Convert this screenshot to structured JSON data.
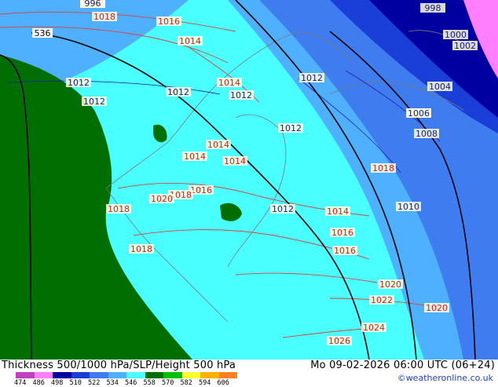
{
  "title": "Thickness 500/1000 hPa/SLP/Height 500 hPa",
  "datetime": "Mo 09-02-2026 06:00 UTC (06+24)",
  "credit": "©weatheronline.co.uk",
  "legend": {
    "ticks": [
      "474",
      "486",
      "498",
      "510",
      "522",
      "534",
      "546",
      "558",
      "570",
      "582",
      "594",
      "606"
    ],
    "colors": [
      "#c040c0",
      "#ff7fff",
      "#0000a0",
      "#1a3fd8",
      "#3f7cf0",
      "#4fb0ff",
      "#49ffff",
      "#006e00",
      "#00c000",
      "#ffff30",
      "#ffb000",
      "#ff8020"
    ]
  },
  "map": {
    "slp_labels": [
      "1020",
      "1018",
      "1016",
      "1014",
      "1012",
      "1012",
      "1012",
      "1014",
      "1012",
      "1012",
      "1012",
      "1014",
      "1014",
      "1014",
      "1016",
      "1018",
      "1020",
      "1018",
      "1012",
      "1014",
      "1016",
      "1016",
      "1018",
      "1020",
      "1022",
      "1024",
      "1026",
      "1020",
      "1018",
      "1010",
      "1012",
      "1008",
      "1006",
      "1004",
      "1002",
      "1000",
      "998",
      "996"
    ],
    "height_labels": [
      "536"
    ]
  }
}
